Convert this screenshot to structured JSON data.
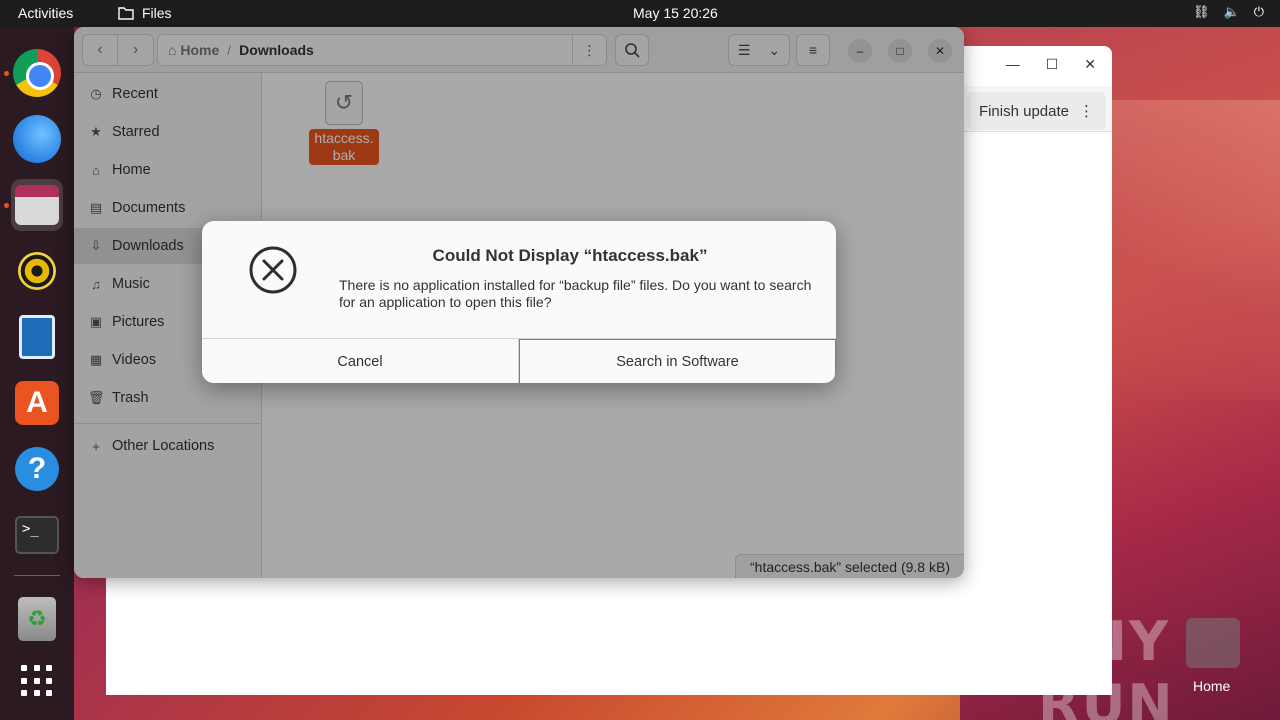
{
  "topbar": {
    "activities": "Activities",
    "app_name": "Files",
    "clock": "May 15  20:26"
  },
  "dock": {
    "items": [
      "chrome",
      "thunderbird",
      "files",
      "rhythmbox",
      "libreoffice-writer",
      "app-center",
      "help",
      "terminal",
      "trash",
      "show-apps"
    ]
  },
  "background_window": {
    "finish_update": "Finish update"
  },
  "files_window": {
    "path": {
      "home": "Home",
      "separator": "/",
      "current": "Downloads"
    },
    "sidebar": [
      {
        "label": "Recent",
        "icon": "clock-icon"
      },
      {
        "label": "Starred",
        "icon": "star-icon"
      },
      {
        "label": "Home",
        "icon": "home-icon"
      },
      {
        "label": "Documents",
        "icon": "document-icon"
      },
      {
        "label": "Downloads",
        "icon": "download-icon",
        "selected": true
      },
      {
        "label": "Music",
        "icon": "music-icon"
      },
      {
        "label": "Pictures",
        "icon": "picture-icon"
      },
      {
        "label": "Videos",
        "icon": "video-icon"
      },
      {
        "label": "Trash",
        "icon": "trash-icon"
      }
    ],
    "other_locations": "Other Locations",
    "file": {
      "name_line1": "htaccess.",
      "name_line2": "bak"
    },
    "status": "“htaccess.bak” selected  (9.8 kB)"
  },
  "dialog": {
    "title": "Could Not Display “htaccess.bak”",
    "message": "There is no application installed for “backup file” files. Do you want to search for an application to open this file?",
    "cancel": "Cancel",
    "search": "Search in Software"
  },
  "watermark": "ANY RUN",
  "desktop": {
    "home_label": "Home"
  },
  "colors": {
    "accent": "#e95420",
    "topbar": "#1d1d1d",
    "dock": "#2b1a22"
  }
}
